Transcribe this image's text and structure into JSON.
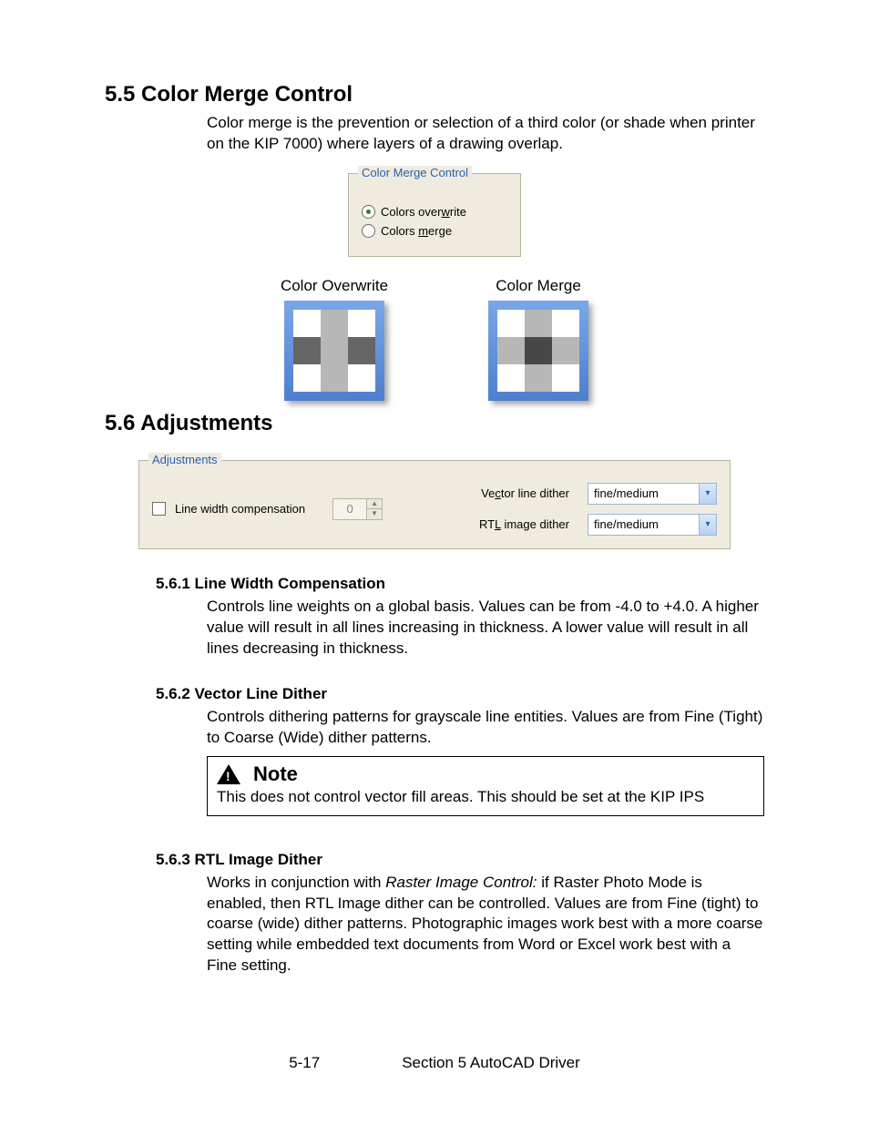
{
  "sections": {
    "s55": {
      "title": "5.5 Color Merge Control",
      "intro": "Color merge is the prevention or selection of a third color (or shade when printer on the KIP 7000) where layers of a drawing overlap."
    },
    "s56": {
      "title": "5.6 Adjustments"
    }
  },
  "color_merge_panel": {
    "legend": "Color Merge Control",
    "opt_overwrite_pre": "Colors over",
    "opt_overwrite_accel": "w",
    "opt_overwrite_post": "rite",
    "opt_merge_pre": "Colors ",
    "opt_merge_accel": "m",
    "opt_merge_post": "erge"
  },
  "examples": {
    "overwrite_label": "Color Overwrite",
    "merge_label": "Color Merge"
  },
  "adjust_panel": {
    "legend": "Adjustments",
    "checkbox_label": "Line width compensation",
    "spinner_value": "0",
    "vector_label_pre": "Ve",
    "vector_label_accel": "c",
    "vector_label_post": "tor line dither",
    "vector_value": "fine/medium",
    "rtl_label_pre": "RT",
    "rtl_label_accel": "L",
    "rtl_label_post": " image dither",
    "rtl_value": "fine/medium"
  },
  "s561": {
    "title": "5.6.1 Line Width Compensation",
    "body": "Controls line weights on a global basis.  Values can be from -4.0 to +4.0.  A higher value will result in all lines increasing in thickness.  A lower value will result in all lines decreasing in thickness."
  },
  "s562": {
    "title": "5.6.2 Vector Line Dither",
    "body": "Controls dithering patterns for grayscale line entities.  Values are from Fine (Tight) to Coarse (Wide) dither patterns."
  },
  "note": {
    "title": "Note",
    "body": "This does not control vector fill areas. This should be set at the KIP IPS"
  },
  "s563": {
    "title": "5.6.3 RTL Image Dither",
    "body_pre": "Works in conjunction with ",
    "body_italic": "Raster Image Control:",
    "body_post": " if Raster Photo Mode is enabled, then RTL Image dither can be controlled.  Values are from Fine (tight) to coarse (wide) dither patterns.  Photographic images work best with a more coarse setting while embedded text documents from Word or Excel work best with a Fine setting."
  },
  "footer": {
    "page": "5-17",
    "section": "Section 5    AutoCAD Driver"
  }
}
